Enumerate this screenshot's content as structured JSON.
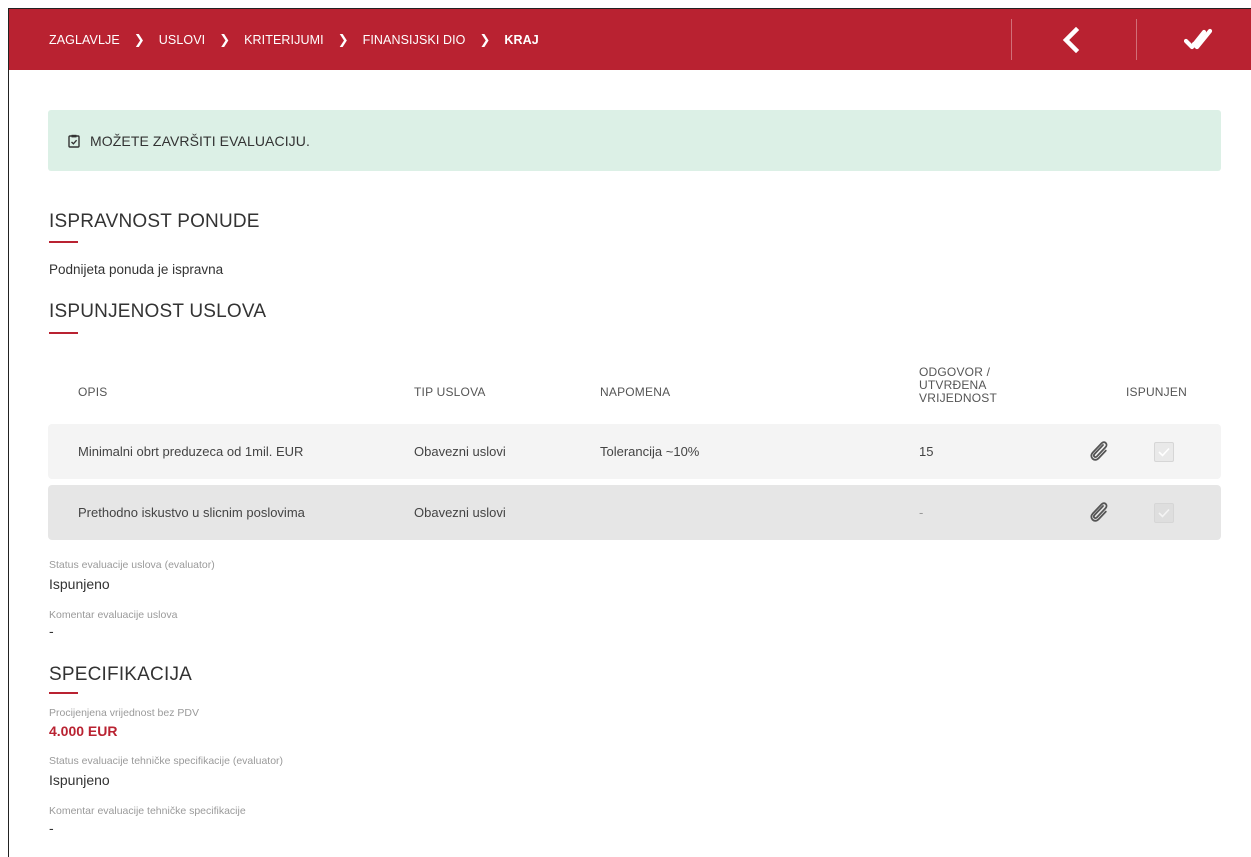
{
  "breadcrumb": {
    "items": [
      {
        "label": "ZAGLAVLJE"
      },
      {
        "label": "USLOVI"
      },
      {
        "label": "KRITERIJUMI"
      },
      {
        "label": "FINANSIJSKI DIO"
      },
      {
        "label": "KRAJ"
      }
    ]
  },
  "alert": {
    "text": "MOŽETE ZAVRŠITI EVALUACIJU."
  },
  "ispravnost": {
    "title": "ISPRAVNOST PONUDE",
    "text": "Podnijeta ponuda je ispravna"
  },
  "ispunjenost": {
    "title": "ISPUNJENOST USLOVA",
    "columns": {
      "opis": "OPIS",
      "tip": "TIP USLOVA",
      "napomena": "NAPOMENA",
      "odgovor_1": "ODGOVOR /",
      "odgovor_2": "UTVRĐENA",
      "odgovor_3": "VRIJEDNOST",
      "ispunjen": "ISPUNJEN"
    },
    "rows": [
      {
        "opis": "Minimalni obrt preduzeca od 1mil. EUR",
        "tip": "Obavezni uslovi",
        "napomena": "Tolerancija ~10%",
        "odgovor": "15"
      },
      {
        "opis": "Prethodno iskustvo u slicnim poslovima",
        "tip": "Obavezni uslovi",
        "napomena": "",
        "odgovor": "-"
      }
    ],
    "status_label": "Status evaluacije uslova (evaluator)",
    "status_value": "Ispunjeno",
    "comment_label": "Komentar evaluacije uslova",
    "comment_value": "-"
  },
  "specifikacija": {
    "title": "SPECIFIKACIJA",
    "value_label": "Procijenjena vrijednost bez PDV",
    "value": "4.000 EUR",
    "status_label": "Status evaluacije tehničke specifikacije (evaluator)",
    "status_value": "Ispunjeno",
    "comment_label": "Komentar evaluacije tehničke specifikacije",
    "comment_value": "-"
  },
  "icons": {
    "back": "chevron-left-icon",
    "finish": "double-check-icon",
    "alert": "clipboard-check-icon",
    "attachment": "paperclip-icon"
  },
  "colors": {
    "brand": "#b92231",
    "alert_bg": "#dcf0e6"
  }
}
